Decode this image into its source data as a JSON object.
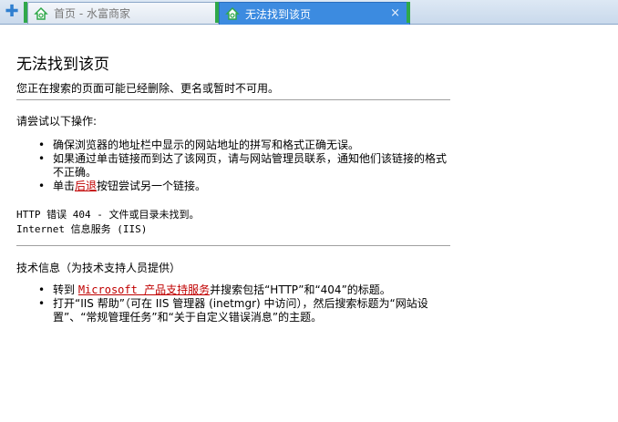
{
  "tabs": [
    {
      "title": "首页 - 水富商家",
      "active": false
    },
    {
      "title": "无法找到该页",
      "active": true
    }
  ],
  "new_tab_icon": "plus-icon",
  "close_glyph": "×",
  "page": {
    "title": "无法找到该页",
    "subtitle": "您正在搜索的页面可能已经删除、更名或暂时不可用。",
    "try_heading": "请尝试以下操作:",
    "try_items": [
      "确保浏览器的地址栏中显示的网站地址的拼写和格式正确无误。",
      "如果通过单击链接而到达了该网页，请与网站管理员联系，通知他们该链接的格式不正确。",
      {
        "before": "单击",
        "link": "后退",
        "after": "按钮尝试另一个链接。"
      }
    ],
    "error_line1": "HTTP 错误 404 - 文件或目录未找到。",
    "error_line2": "Internet 信息服务 (IIS)",
    "tech_heading": "技术信息（为技术支持人员提供）",
    "tech_items": [
      {
        "before": "转到 ",
        "link": "Microsoft 产品支持服务",
        "after": "并搜索包括“HTTP”和“404”的标题。"
      },
      "打开“IIS 帮助”（可在 IIS 管理器 (inetmgr) 中访问），然后搜索标题为“网站设置”、“常规管理任务”和“关于自定义错误消息”的主题。"
    ]
  },
  "colors": {
    "tab_active": "#3c8be0",
    "tab_marker": "#2fa84a",
    "link": "#c00000"
  }
}
